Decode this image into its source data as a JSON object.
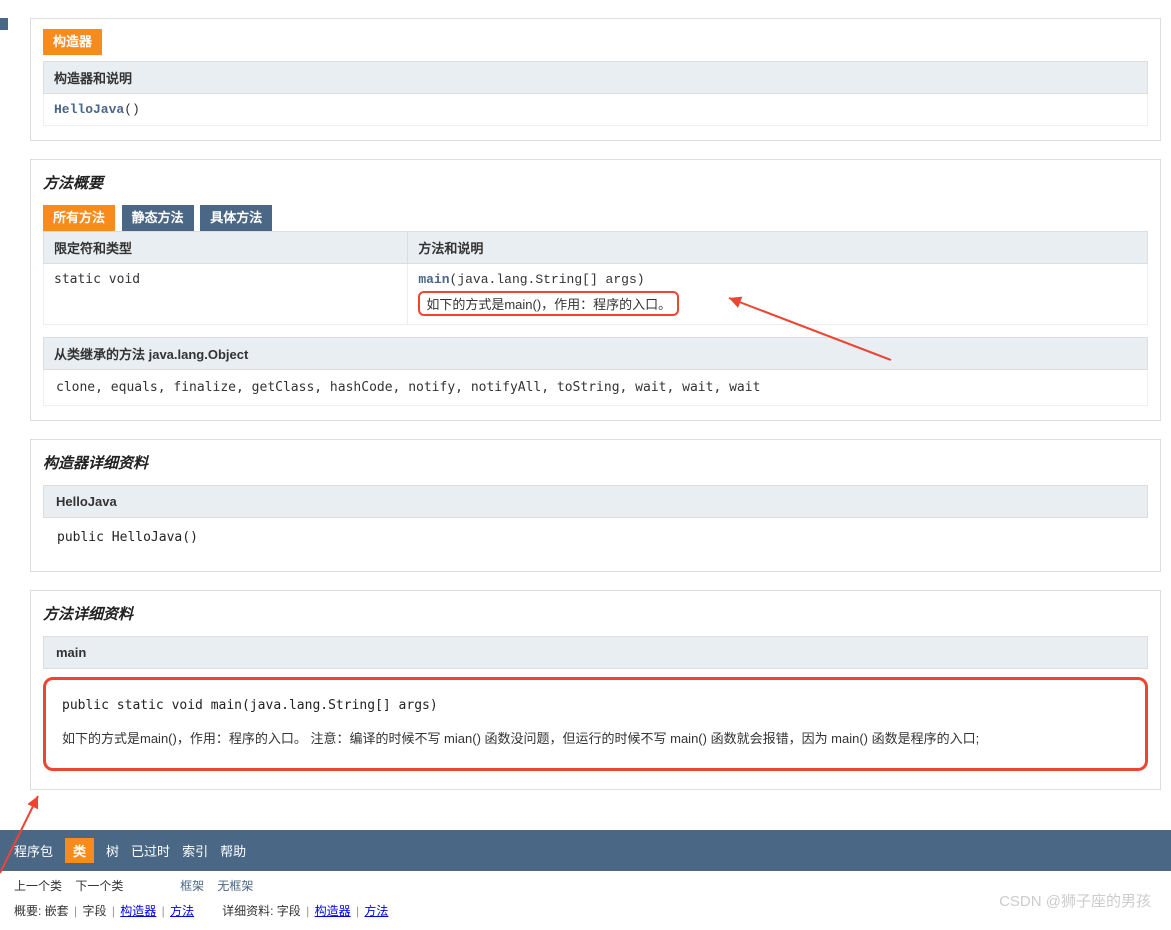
{
  "constructors": {
    "tab": "构造器",
    "header": "构造器和说明",
    "item_link": "HelloJava",
    "item_parens": "()"
  },
  "methods_summary": {
    "title": "方法概要",
    "tabs": {
      "all": "所有方法",
      "static": "静态方法",
      "concrete": "具体方法"
    },
    "col1": "限定符和类型",
    "col2": "方法和说明",
    "row": {
      "modifier": "static void",
      "name": "main",
      "sig_params": "(java.lang.String[]  args)",
      "desc": "如下的方式是main()，作用：程序的入口。"
    },
    "inherited_header": "从类继承的方法 java.lang.Object",
    "inherited_list": "clone, equals, finalize, getClass, hashCode, notify, notifyAll, toString, wait, wait, wait"
  },
  "constructor_detail": {
    "title": "构造器详细资料",
    "header": "HelloJava",
    "sig_pre": "public  ",
    "sig_name": "HelloJava()"
  },
  "method_detail": {
    "title": "方法详细资料",
    "header": "main",
    "sig": "public static  void  main(java.lang.String[]  args)",
    "desc": "如下的方式是main()，作用：程序的入口。 注意：编译的时候不写 mian() 函数没问题，但运行的时候不写 main() 函数就会报错，因为 main() 函数是程序的入口;"
  },
  "bottom_nav": {
    "items": [
      "程序包",
      "类",
      "树",
      "已过时",
      "索引",
      "帮助"
    ],
    "active_index": 1
  },
  "sub_nav": {
    "left": [
      "上一个类",
      "下一个类"
    ],
    "right": [
      "框架",
      "无框架"
    ]
  },
  "final_line": {
    "label1": "概要:",
    "parts1": [
      "嵌套",
      "字段"
    ],
    "links1": [
      "构造器",
      "方法"
    ],
    "label2": "详细资料:",
    "parts2": [
      "字段"
    ],
    "links2": [
      "构造器",
      "方法"
    ]
  },
  "watermark": "CSDN @狮子座的男孩"
}
